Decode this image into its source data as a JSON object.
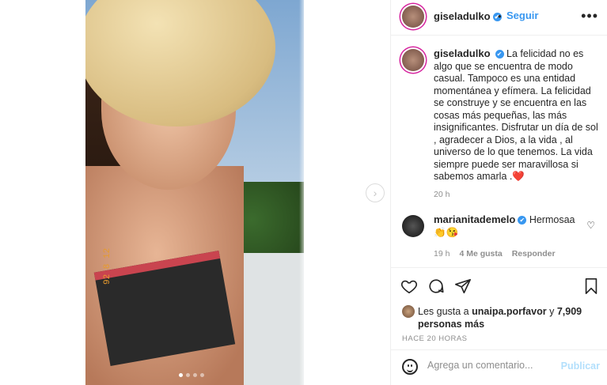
{
  "post": {
    "photo_date_stamp": "92 8 12",
    "carousel": {
      "total": 4,
      "active_index": 0
    },
    "next_glyph": "›"
  },
  "header": {
    "username": "giseladulko",
    "verified_glyph": "✔",
    "separator": "•",
    "follow_label": "Seguir",
    "more_glyph": "•••"
  },
  "caption": {
    "username": "giseladulko",
    "text": "La felicidad no es algo que se encuentra de modo casual. Tampoco es una entidad momentánea y efímera. La felicidad se construye y se encuentra en las cosas más pequeñas, las más insignificantes. Disfrutar un día de sol , agradecer a Dios, a la vida , al universo de lo que tenemos. La vida siempre puede ser maravillosa si sabemos amarla .❤️",
    "time": "20 h"
  },
  "comment": {
    "username": "marianitademelo",
    "text": "Hermosaa👏😘",
    "time": "19 h",
    "likes": "4 Me gusta",
    "reply_label": "Responder",
    "heart_glyph": "♡"
  },
  "likes": {
    "prefix": "Les gusta a",
    "user": "unaipa.porfavor",
    "conj": "y",
    "others": "7,909 personas más"
  },
  "timeago": "HACE 20 HORAS",
  "add_comment": {
    "placeholder": "Agrega un comentario...",
    "publish_label": "Publicar"
  },
  "colors": {
    "accent": "#3897f0",
    "publish_disabled": "#b2dffc",
    "muted": "#8e8e8e",
    "text": "#262626"
  }
}
